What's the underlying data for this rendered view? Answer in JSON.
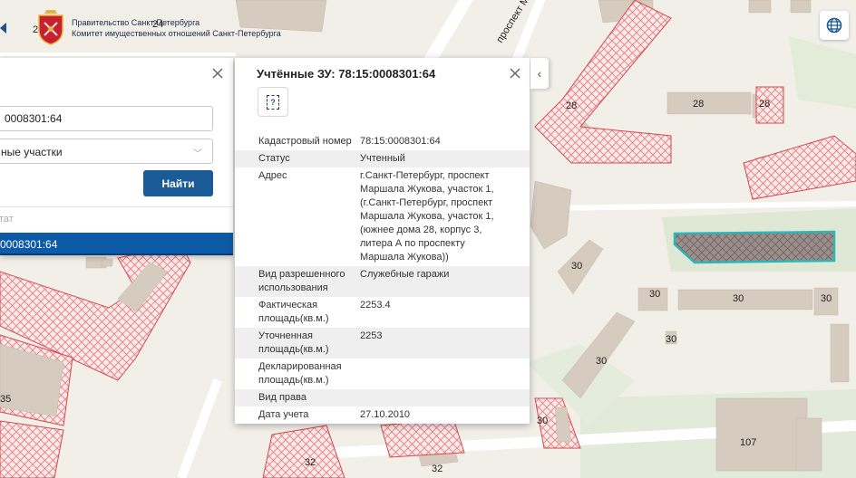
{
  "header": {
    "line1": "Правительство Санкт-Петербурга",
    "line2": "Комитет имущественных отношений Санкт-Петербурга"
  },
  "map": {
    "street_label": "проспект Маршала",
    "numbers": {
      "n24": "24",
      "n20": "20",
      "n28a": "28",
      "n28b": "28",
      "n28c": "28",
      "n30a": "30",
      "n30b": "30",
      "n30c": "30",
      "n30d": "30",
      "n30e": "30",
      "n30f": "30",
      "n30g": "30",
      "n35": "35",
      "n32a": "32",
      "n32b": "32",
      "n107": "107"
    }
  },
  "search": {
    "input_value": "0008301:64",
    "select_value": "ные участки",
    "find_label": "Найти",
    "result_header": "тат",
    "result_item": "0008301:64"
  },
  "info": {
    "title": "Учтённые ЗУ: 78:15:0008301:64",
    "icon_glyph": "?",
    "rows": [
      {
        "k": "Кадастровый номер",
        "v": "78:15:0008301:64"
      },
      {
        "k": "Статус",
        "v": "Учтенный"
      },
      {
        "k": "Адрес",
        "v": "г.Санкт-Петербург, проспект Маршала Жукова, участок 1, (г.Санкт-Петербург, проспект Маршала Жукова, участок 1, (южнее дома 28, корпус 3, литера А по проспекту Маршала Жукова))"
      },
      {
        "k": "Вид разрешенного использования",
        "v": "Служебные гаражи"
      },
      {
        "k": "Фактическая площадь(кв.м.)",
        "v": "2253.4"
      },
      {
        "k": "Уточненная площадь(кв.м.)",
        "v": "2253"
      },
      {
        "k": "Декларированная площадь(кв.м.)",
        "v": ""
      },
      {
        "k": "Вид права",
        "v": ""
      },
      {
        "k": "Дата учета",
        "v": "27.10.2010"
      }
    ]
  },
  "colors": {
    "accent": "#1a5a96",
    "selected": "#0d5aa6",
    "highlight_outline": "#2bb6b8",
    "hatch": "#e8777a",
    "building": "#d6cbbf"
  }
}
